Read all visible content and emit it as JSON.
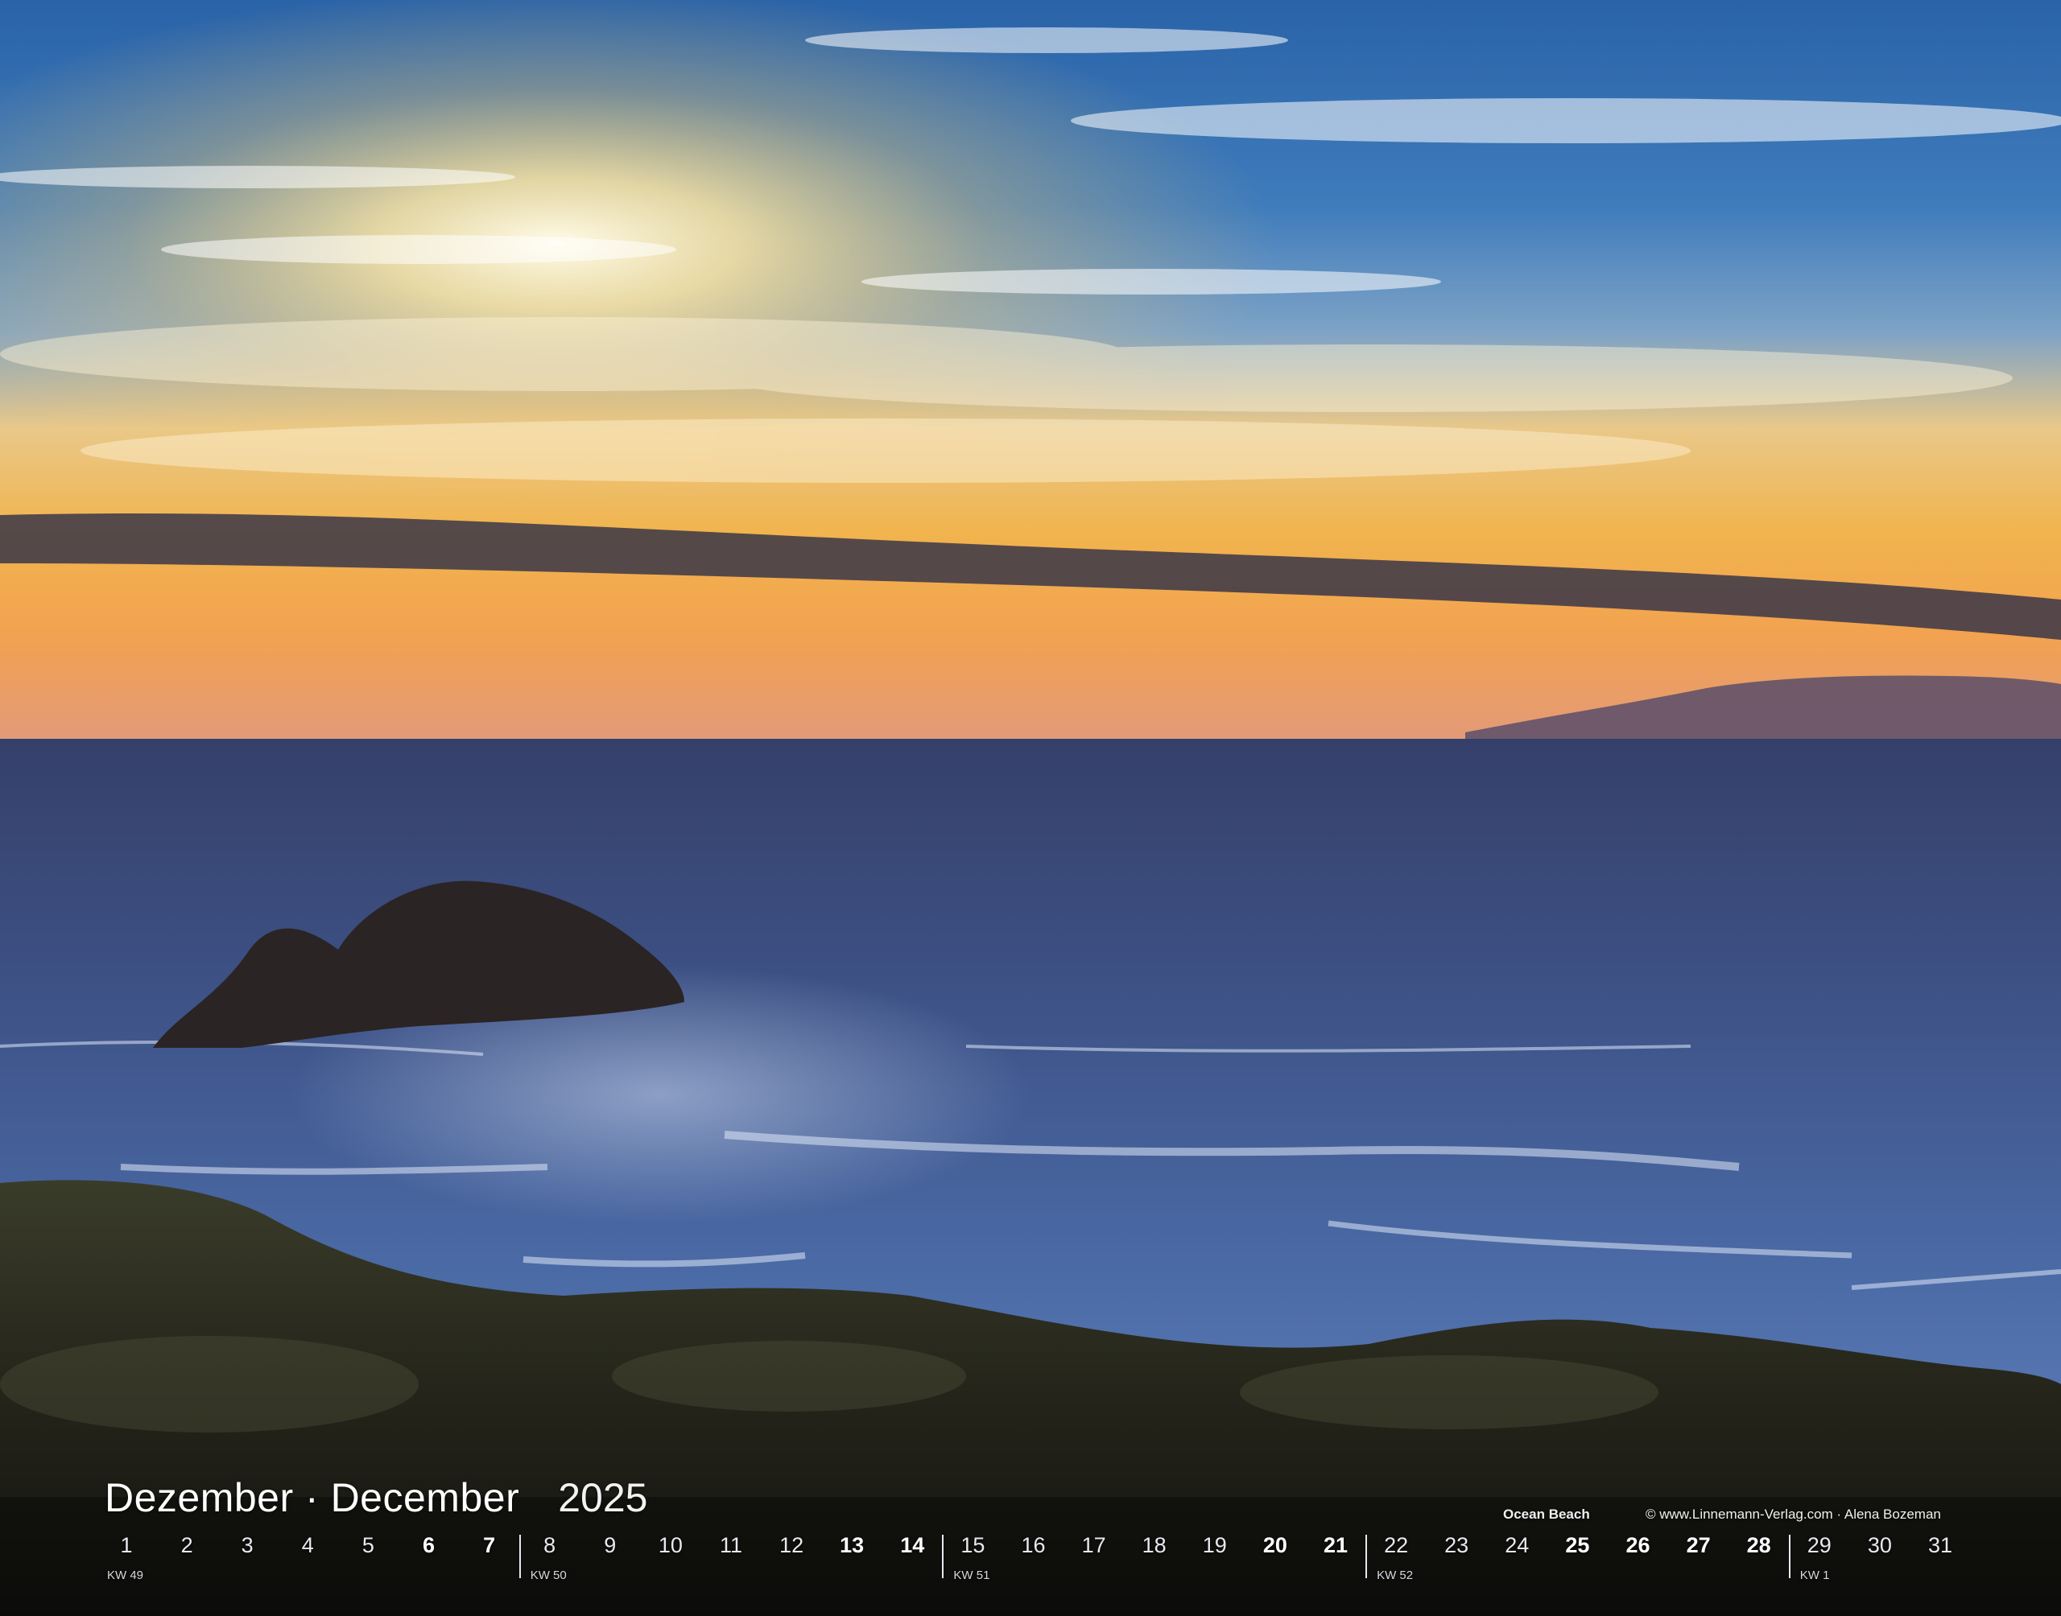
{
  "calendar": {
    "month_label": "Dezember · December",
    "year": "2025",
    "location": "Ocean Beach",
    "credit": "© www.Linnemann-Verlag.com · Alena Bozeman",
    "days": [
      {
        "n": "1",
        "we": false
      },
      {
        "n": "2",
        "we": false
      },
      {
        "n": "3",
        "we": false
      },
      {
        "n": "4",
        "we": false
      },
      {
        "n": "5",
        "we": false
      },
      {
        "n": "6",
        "we": true
      },
      {
        "n": "7",
        "we": true
      },
      {
        "n": "8",
        "we": false
      },
      {
        "n": "9",
        "we": false
      },
      {
        "n": "10",
        "we": false
      },
      {
        "n": "11",
        "we": false
      },
      {
        "n": "12",
        "we": false
      },
      {
        "n": "13",
        "we": true
      },
      {
        "n": "14",
        "we": true
      },
      {
        "n": "15",
        "we": false
      },
      {
        "n": "16",
        "we": false
      },
      {
        "n": "17",
        "we": false
      },
      {
        "n": "18",
        "we": false
      },
      {
        "n": "19",
        "we": false
      },
      {
        "n": "20",
        "we": true
      },
      {
        "n": "21",
        "we": true
      },
      {
        "n": "22",
        "we": false
      },
      {
        "n": "23",
        "we": false
      },
      {
        "n": "24",
        "we": false
      },
      {
        "n": "25",
        "we": true
      },
      {
        "n": "26",
        "we": true
      },
      {
        "n": "27",
        "we": true
      },
      {
        "n": "28",
        "we": true
      },
      {
        "n": "29",
        "we": false
      },
      {
        "n": "30",
        "we": false
      },
      {
        "n": "31",
        "we": false
      }
    ],
    "weeks": [
      {
        "label": "KW 49",
        "first_day": "1"
      },
      {
        "label": "KW 50",
        "first_day": "8"
      },
      {
        "label": "KW 51",
        "first_day": "15"
      },
      {
        "label": "KW 52",
        "first_day": "22"
      },
      {
        "label": "KW 1",
        "first_day": "29"
      }
    ]
  },
  "photo": {
    "subject": "sunset over the ocean",
    "colors": {
      "sky_top": "#2f6db0",
      "sky_mid": "#6a9fd0",
      "horizon": "#f4b24a",
      "sea": "#3a4f80",
      "land": "#2e2c22"
    }
  }
}
